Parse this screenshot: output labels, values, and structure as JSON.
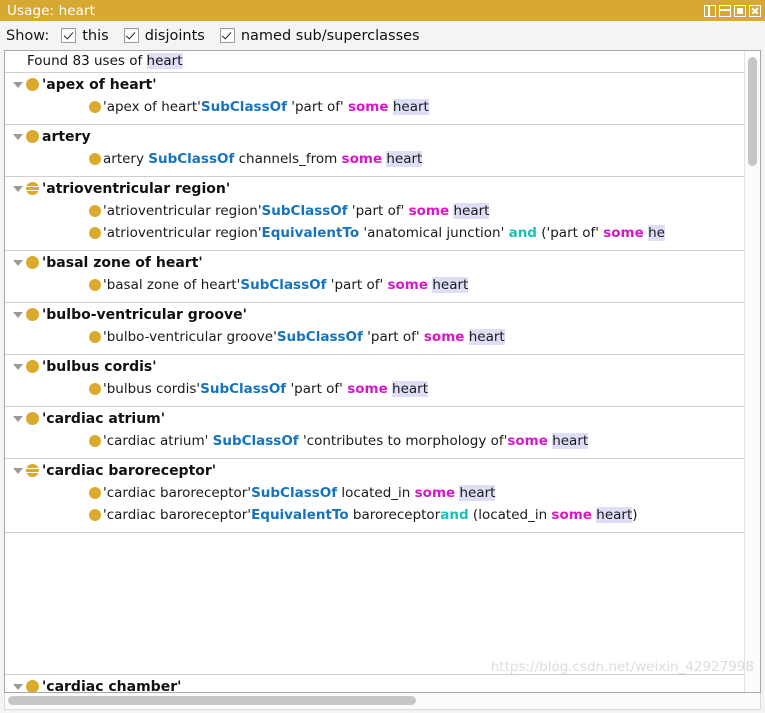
{
  "window": {
    "title": "Usage: heart",
    "accent_color": "#d7a932",
    "controls": [
      {
        "name": "split-view-button",
        "label": "Split"
      },
      {
        "name": "stack-view-button",
        "label": "Stack"
      },
      {
        "name": "maximize-button",
        "label": "Maximize"
      },
      {
        "name": "close-button",
        "label": "Close"
      }
    ]
  },
  "filter_bar": {
    "label": "Show:",
    "options": [
      {
        "label": "this",
        "checked": true
      },
      {
        "label": "disjoints",
        "checked": true
      },
      {
        "label": "named sub/superclasses",
        "checked": true
      }
    ]
  },
  "results": {
    "summary_prefix": "Found 83 uses of ",
    "summary_term": "heart",
    "count": 83,
    "search_term": "heart",
    "groups": [
      {
        "name": "'apex of heart'",
        "icon": "class-icon",
        "expanded": true,
        "axioms": [
          {
            "icon": "class-icon",
            "parts": [
              {
                "t": "'apex of heart'",
                "s": "plain"
              },
              {
                "t": "SubClassOf",
                "s": "kw"
              },
              {
                "t": " ",
                "s": "plain"
              },
              {
                "t": "'part of'",
                "s": "plain"
              },
              {
                "t": " ",
                "s": "plain"
              },
              {
                "t": "some",
                "s": "some"
              },
              {
                "t": " ",
                "s": "plain"
              },
              {
                "t": "heart",
                "s": "hl"
              }
            ]
          }
        ]
      },
      {
        "name": "artery",
        "icon": "class-icon",
        "expanded": true,
        "axioms": [
          {
            "icon": "class-icon",
            "parts": [
              {
                "t": "artery ",
                "s": "plain"
              },
              {
                "t": "SubClassOf",
                "s": "kw"
              },
              {
                "t": " channels_from ",
                "s": "plain"
              },
              {
                "t": "some",
                "s": "some"
              },
              {
                "t": " ",
                "s": "plain"
              },
              {
                "t": "heart",
                "s": "hl"
              }
            ]
          }
        ]
      },
      {
        "name": "'atrioventricular region'",
        "icon": "defined-class-icon",
        "expanded": true,
        "axioms": [
          {
            "icon": "class-icon",
            "parts": [
              {
                "t": "'atrioventricular region'",
                "s": "plain"
              },
              {
                "t": "SubClassOf",
                "s": "kw"
              },
              {
                "t": " ",
                "s": "plain"
              },
              {
                "t": "'part of'",
                "s": "plain"
              },
              {
                "t": " ",
                "s": "plain"
              },
              {
                "t": "some",
                "s": "some"
              },
              {
                "t": " ",
                "s": "plain"
              },
              {
                "t": "heart",
                "s": "hl"
              }
            ]
          },
          {
            "icon": "class-icon",
            "parts": [
              {
                "t": "'atrioventricular region'",
                "s": "plain"
              },
              {
                "t": "EquivalentTo",
                "s": "kw"
              },
              {
                "t": " 'anatomical junction'",
                "s": "plain"
              },
              {
                "t": " ",
                "s": "plain"
              },
              {
                "t": "and",
                "s": "and"
              },
              {
                "t": " ('part of'",
                "s": "plain"
              },
              {
                "t": " ",
                "s": "plain"
              },
              {
                "t": "some",
                "s": "some"
              },
              {
                "t": " ",
                "s": "plain"
              },
              {
                "t": "he",
                "s": "hl"
              }
            ]
          }
        ]
      },
      {
        "name": "'basal zone of heart'",
        "icon": "class-icon",
        "expanded": true,
        "axioms": [
          {
            "icon": "class-icon",
            "parts": [
              {
                "t": "'basal zone of heart'",
                "s": "plain"
              },
              {
                "t": "SubClassOf",
                "s": "kw"
              },
              {
                "t": " ",
                "s": "plain"
              },
              {
                "t": "'part of'",
                "s": "plain"
              },
              {
                "t": " ",
                "s": "plain"
              },
              {
                "t": "some",
                "s": "some"
              },
              {
                "t": " ",
                "s": "plain"
              },
              {
                "t": "heart",
                "s": "hl"
              }
            ]
          }
        ]
      },
      {
        "name": "'bulbo-ventricular groove'",
        "icon": "class-icon",
        "expanded": true,
        "axioms": [
          {
            "icon": "class-icon",
            "parts": [
              {
                "t": "'bulbo-ventricular groove'",
                "s": "plain"
              },
              {
                "t": "SubClassOf",
                "s": "kw"
              },
              {
                "t": " ",
                "s": "plain"
              },
              {
                "t": "'part of'",
                "s": "plain"
              },
              {
                "t": " ",
                "s": "plain"
              },
              {
                "t": "some",
                "s": "some"
              },
              {
                "t": " ",
                "s": "plain"
              },
              {
                "t": "heart",
                "s": "hl"
              }
            ]
          }
        ]
      },
      {
        "name": "'bulbus cordis'",
        "icon": "class-icon",
        "expanded": true,
        "axioms": [
          {
            "icon": "class-icon",
            "parts": [
              {
                "t": "'bulbus cordis'",
                "s": "plain"
              },
              {
                "t": "SubClassOf",
                "s": "kw"
              },
              {
                "t": " ",
                "s": "plain"
              },
              {
                "t": "'part of'",
                "s": "plain"
              },
              {
                "t": " ",
                "s": "plain"
              },
              {
                "t": "some",
                "s": "some"
              },
              {
                "t": " ",
                "s": "plain"
              },
              {
                "t": "heart",
                "s": "hl"
              }
            ]
          }
        ]
      },
      {
        "name": "'cardiac atrium'",
        "icon": "class-icon",
        "expanded": true,
        "axioms": [
          {
            "icon": "class-icon",
            "parts": [
              {
                "t": "'cardiac atrium' ",
                "s": "plain"
              },
              {
                "t": "SubClassOf",
                "s": "kw"
              },
              {
                "t": " 'contributes to morphology of'",
                "s": "plain"
              },
              {
                "t": "some",
                "s": "some"
              },
              {
                "t": " ",
                "s": "plain"
              },
              {
                "t": "heart",
                "s": "hl"
              }
            ]
          }
        ]
      },
      {
        "name": "'cardiac baroreceptor'",
        "icon": "defined-class-icon",
        "expanded": true,
        "axioms": [
          {
            "icon": "class-icon",
            "parts": [
              {
                "t": "'cardiac baroreceptor'",
                "s": "plain"
              },
              {
                "t": "SubClassOf",
                "s": "kw"
              },
              {
                "t": " located_in ",
                "s": "plain"
              },
              {
                "t": "some",
                "s": "some"
              },
              {
                "t": " ",
                "s": "plain"
              },
              {
                "t": "heart",
                "s": "hl"
              }
            ]
          },
          {
            "icon": "class-icon",
            "parts": [
              {
                "t": "'cardiac baroreceptor'",
                "s": "plain"
              },
              {
                "t": "EquivalentTo",
                "s": "kw"
              },
              {
                "t": " baroreceptor",
                "s": "plain"
              },
              {
                "t": "and",
                "s": "and"
              },
              {
                "t": " (located_in ",
                "s": "plain"
              },
              {
                "t": "some",
                "s": "some"
              },
              {
                "t": " ",
                "s": "plain"
              },
              {
                "t": "heart",
                "s": "hl"
              },
              {
                "t": ")",
                "s": "plain"
              }
            ]
          }
        ]
      }
    ],
    "clipped_group": {
      "name": "'cardiac chamber'",
      "icon": "class-icon"
    }
  },
  "scrollbars": {
    "vertical": {
      "thumb_top_pct": 1,
      "thumb_height_pct": 17
    },
    "horizontal": {
      "thumb_left_pct": 0,
      "thumb_width_pct": 54
    }
  },
  "watermark": "https://blog.csdn.net/weixin_42927998"
}
